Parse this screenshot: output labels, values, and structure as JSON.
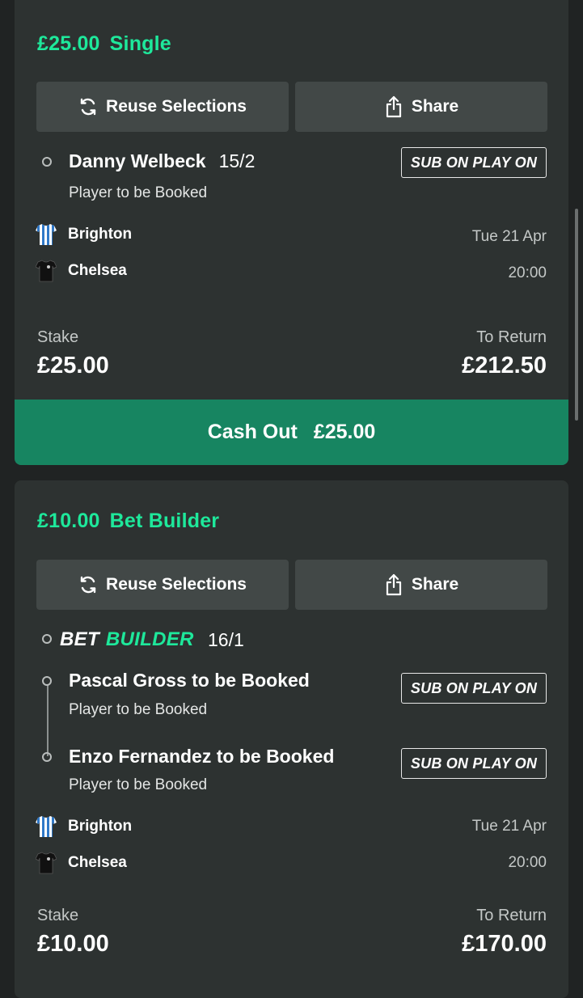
{
  "colors": {
    "accent": "#1ee89b",
    "cashout": "#178561",
    "card": "#2d3231",
    "button": "#424847"
  },
  "bets": [
    {
      "stake_display": "£25.00",
      "bet_type": "Single",
      "reuse_label": "Reuse Selections",
      "share_label": "Share",
      "selection": {
        "name": "Danny Welbeck",
        "odds": "15/2",
        "market": "Player to be Booked",
        "badge": "SUB ON PLAY ON"
      },
      "home_team": "Brighton",
      "away_team": "Chelsea",
      "date": "Tue 21 Apr",
      "time": "20:00",
      "stake_label": "Stake",
      "stake": "£25.00",
      "return_label": "To Return",
      "to_return": "£212.50",
      "cashout_label": "Cash Out",
      "cashout_amount": "£25.00"
    },
    {
      "stake_display": "£10.00",
      "bet_type": "Bet Builder",
      "reuse_label": "Reuse Selections",
      "share_label": "Share",
      "builder_logo_a": "BET",
      "builder_logo_b": "BUILDER",
      "odds": "16/1",
      "legs": [
        {
          "name": "Pascal Gross to be Booked",
          "market": "Player to be Booked",
          "badge": "SUB ON PLAY ON"
        },
        {
          "name": "Enzo Fernandez to be Booked",
          "market": "Player to be Booked",
          "badge": "SUB ON PLAY ON"
        }
      ],
      "home_team": "Brighton",
      "away_team": "Chelsea",
      "date": "Tue 21 Apr",
      "time": "20:00",
      "stake_label": "Stake",
      "stake": "£10.00",
      "return_label": "To Return",
      "to_return": "£170.00"
    }
  ],
  "icons": {
    "reuse": "refresh-icon",
    "share": "share-icon",
    "home_kit": "striped-shirt-icon",
    "away_kit": "black-shirt-icon"
  }
}
